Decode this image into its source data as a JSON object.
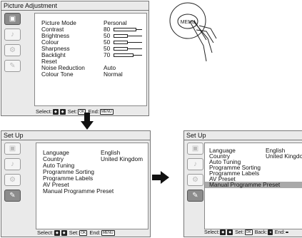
{
  "panel1": {
    "title": "Picture Adjustment",
    "rows": [
      {
        "label": "Picture Mode",
        "value": "Personal"
      },
      {
        "label": "Contrast",
        "value": "80",
        "level": 0.8
      },
      {
        "label": "Brightness",
        "value": "50",
        "level": 0.5
      },
      {
        "label": "Colour",
        "value": "50",
        "level": 0.5
      },
      {
        "label": "Sharpness",
        "value": "50",
        "level": 0.5
      },
      {
        "label": "Backlight",
        "value": "70",
        "level": 0.7
      },
      {
        "label": "Reset",
        "value": ""
      },
      {
        "label": "Noise Reduction",
        "value": "Auto"
      },
      {
        "label": "Colour Tone",
        "value": "Normal"
      }
    ],
    "footer": {
      "select": "Select:",
      "set": "Set:",
      "ok_key": "OK",
      "end": "End:",
      "menu_key": "MENU"
    }
  },
  "remote": {
    "button_label": "MENU"
  },
  "panel2": {
    "title": "Set Up",
    "rows": [
      {
        "label": "Language",
        "value": "English"
      },
      {
        "label": "Country",
        "value": "United Kingdom"
      },
      {
        "label": "Auto Tuning",
        "value": ""
      },
      {
        "label": "Programme Sorting",
        "value": ""
      },
      {
        "label": "Programme Labels",
        "value": ""
      },
      {
        "label": "AV Preset",
        "value": ""
      },
      {
        "label": "Manual Programme Preset",
        "value": ""
      }
    ],
    "footer": {
      "select": "Select:",
      "set": "Set:",
      "ok_key": "OK",
      "end": "End:",
      "menu_key": "MENU"
    }
  },
  "panel3": {
    "title": "Set Up",
    "rows": [
      {
        "label": "Language",
        "value": "English"
      },
      {
        "label": "Country",
        "value": "United Kingdo"
      },
      {
        "label": "Auto Tuning",
        "value": ""
      },
      {
        "label": "Programme Sorting",
        "value": ""
      },
      {
        "label": "Programme Labels",
        "value": ""
      },
      {
        "label": "AV Preset",
        "value": ""
      },
      {
        "label": "Manual Programme Preset",
        "value": "",
        "highlighted": true
      }
    ],
    "footer": {
      "select": "Select:",
      "set": "Set:",
      "ok_key": "OK",
      "back": "Back:",
      "end": "End:"
    }
  },
  "icons": [
    "picture-icon",
    "sound-icon",
    "features-icon",
    "setup-icon"
  ]
}
